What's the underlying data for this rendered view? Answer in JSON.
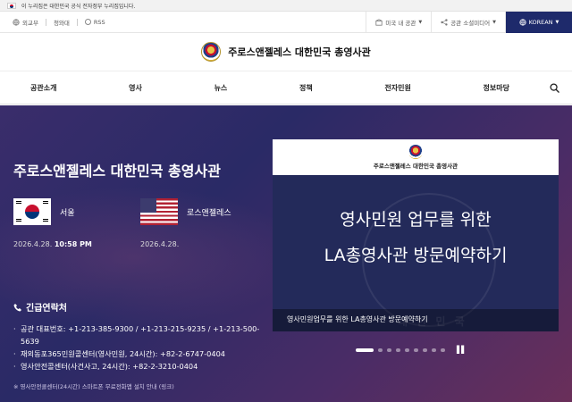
{
  "gov_banner": {
    "text": "이 누리집은 대한민국 공식 전자정부 누리집입니다."
  },
  "utility": {
    "left_links": [
      "외교부",
      "청와대",
      "RSS"
    ],
    "dropdown1": "미국 내 공관",
    "dropdown2": "공관 소셜미디어",
    "language": "KOREAN"
  },
  "logo": {
    "text": "주로스앤젤레스 대한민국 총영사관"
  },
  "nav": {
    "items": [
      "공관소개",
      "영사",
      "뉴스",
      "정책",
      "전자민원",
      "정보마당"
    ]
  },
  "hero": {
    "title": "주로스앤젤레스 대한민국 총영사관",
    "seoul": {
      "label": "서울",
      "date": "2026.4.28.",
      "time": "10:58 PM"
    },
    "la": {
      "label": "로스앤젤레스",
      "date": "2026.4.28."
    }
  },
  "emergency": {
    "heading": "긴급연락처",
    "lines": [
      "공관 대표번호: +1-213-385-9300 / +1-213-215-9235 / +1-213-500-5639",
      "재외동포365민원콜센터(영사민원, 24시간): +82-2-6747-0404",
      "영사안전콜센터(사건사고, 24시간): +82-2-3210-0404"
    ],
    "note": "※ 영사안전콜센터(24시간) 스마트폰 무료전화앱 설치 안내 (링크)"
  },
  "slide": {
    "header_title": "주로스앤젤레스 대한민국 총영사관",
    "line1": "영사민원 업무를 위한",
    "line2": "LA총영사관 방문예약하기",
    "seal_text": "대 한 민 국",
    "caption": "영사민원업무를 위한 LA총영사관 방문예약하기"
  },
  "colors": {
    "hero_bg": "#2f2a66",
    "lang_bg": "#1e2a6b"
  }
}
